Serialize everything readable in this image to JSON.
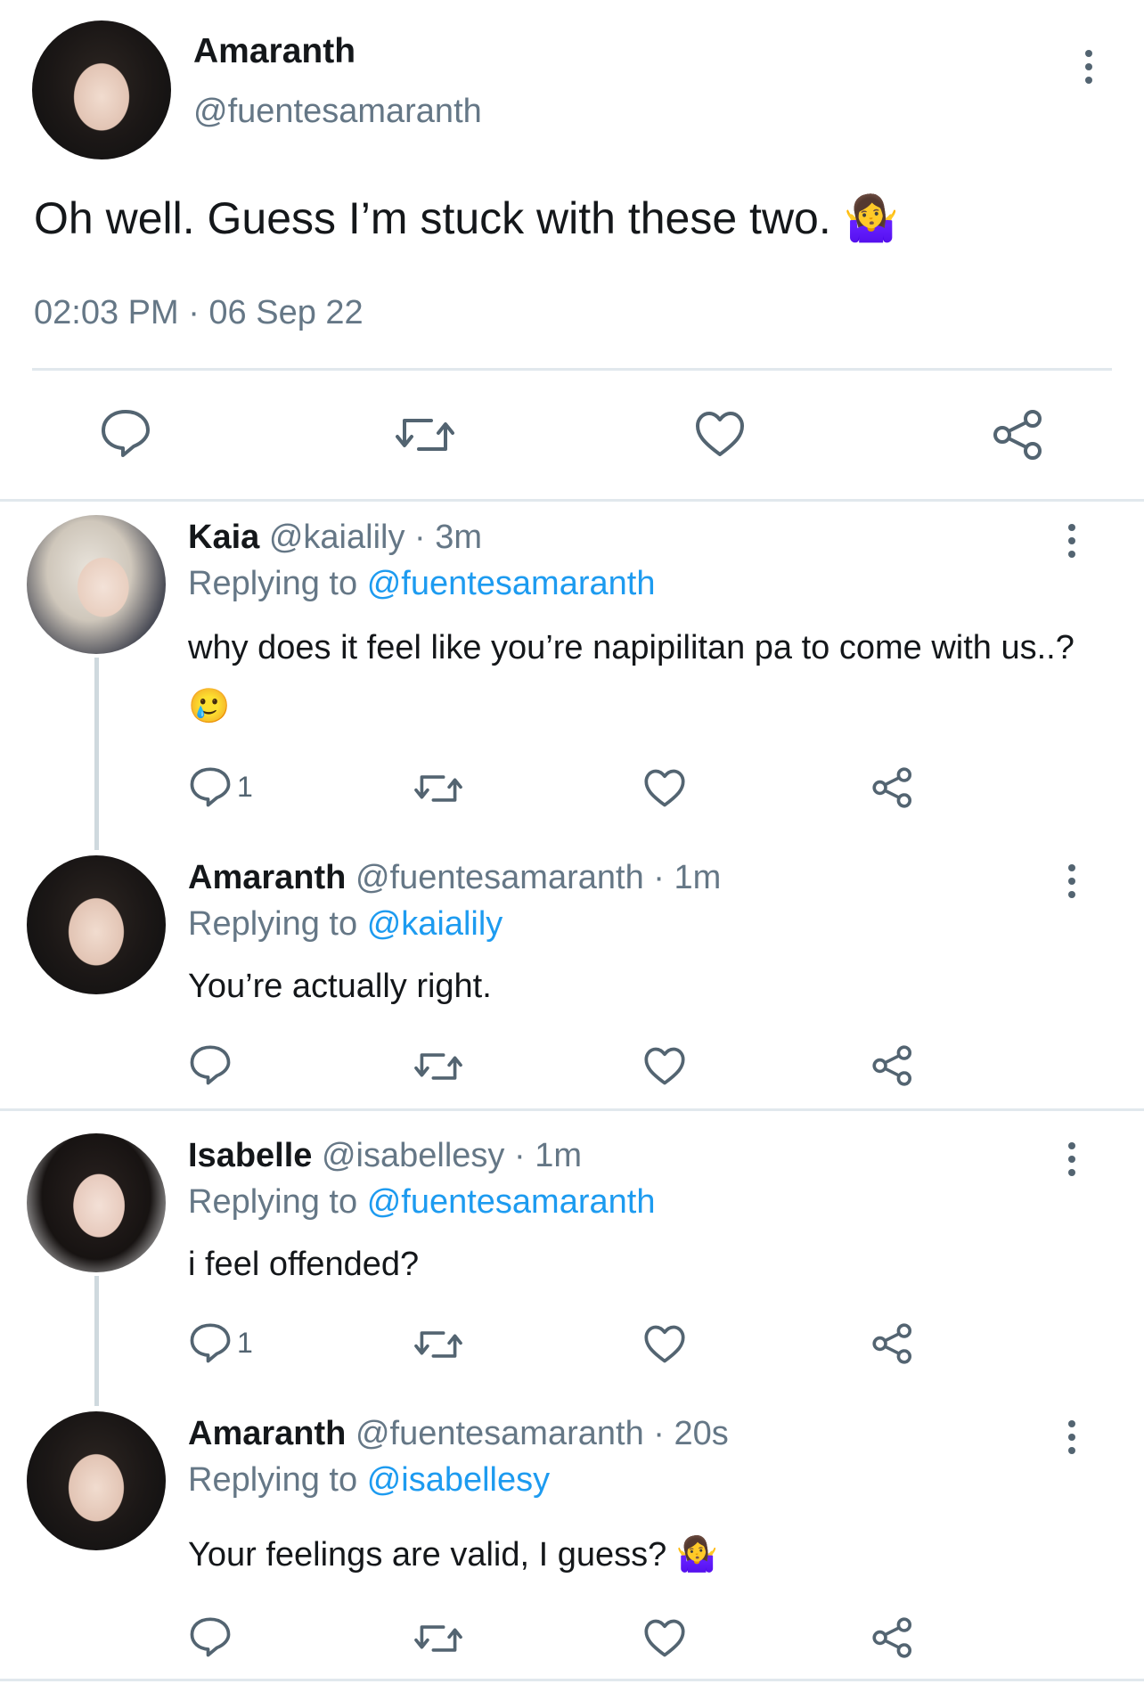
{
  "main_tweet": {
    "name": "Amaranth",
    "handle": "@fuentesamaranth",
    "text": "Oh well. Guess I’m stuck with these two. 🤷‍♀️",
    "timestamp": "02:03 PM · 06 Sep 22",
    "actions": [
      "reply-icon",
      "retweet-icon",
      "like-icon",
      "share-icon"
    ]
  },
  "replies": [
    {
      "name": "Kaia",
      "meta": "@kaialily · 3m",
      "replying_prefix": "Replying to",
      "replying_to": "@fuentesamaranth",
      "text": "why does it feel like you’re napipilitan pa to come with us..? 🥲",
      "reply_count": "1"
    },
    {
      "name": "Amaranth",
      "meta": "@fuentesamaranth · 1m",
      "replying_prefix": "Replying to",
      "replying_to": "@kaialily",
      "text": "You’re actually right.",
      "reply_count": ""
    },
    {
      "name": "Isabelle",
      "meta": "@isabellesy · 1m",
      "replying_prefix": "Replying to",
      "replying_to": "@fuentesamaranth",
      "text": "i feel offended?",
      "reply_count": "1"
    },
    {
      "name": "Amaranth",
      "meta": "@fuentesamaranth · 20s",
      "replying_prefix": "Replying to",
      "replying_to": "@isabellesy",
      "text": "Your feelings are valid, I guess? 🤷‍♀️",
      "reply_count": ""
    }
  ],
  "colors": {
    "link": "#1d9bf0",
    "muted": "#657786",
    "divider": "#e1e8ed",
    "icon": "#536471"
  }
}
